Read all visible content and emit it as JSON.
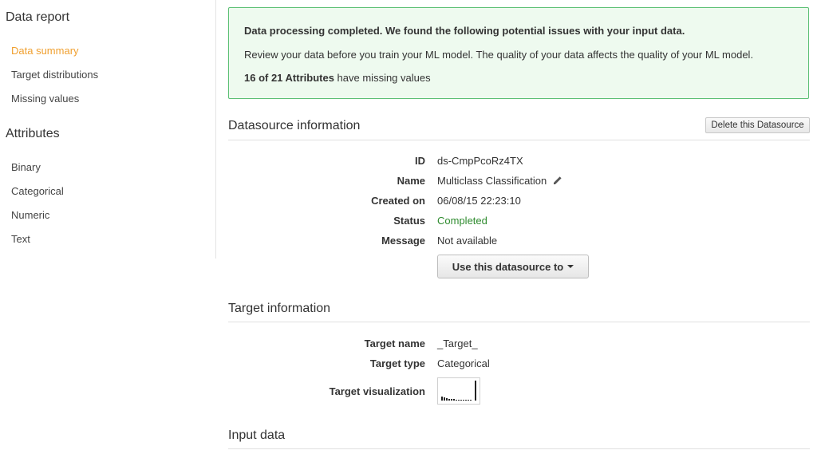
{
  "sidebar": {
    "heading_report": "Data report",
    "report_items": [
      "Data summary",
      "Target distributions",
      "Missing values"
    ],
    "heading_attributes": "Attributes",
    "attribute_items": [
      "Binary",
      "Categorical",
      "Numeric",
      "Text"
    ]
  },
  "alert": {
    "title": "Data processing completed. We found the following potential issues with your input data.",
    "message": "Review your data before you train your ML model. The quality of your data affects the quality of your ML model.",
    "missing_count": "16 of 21 Attributes",
    "missing_suffix": " have missing values"
  },
  "datasource": {
    "title": "Datasource information",
    "delete_label": "Delete this Datasource",
    "id_label": "ID",
    "id_value": "ds-CmpPcoRz4TX",
    "name_label": "Name",
    "name_value": "Multiclass Classification",
    "created_label": "Created on",
    "created_value": "06/08/15 22:23:10",
    "status_label": "Status",
    "status_value": "Completed",
    "message_label": "Message",
    "message_value": "Not available",
    "use_button_label": "Use this datasource to"
  },
  "target": {
    "title": "Target information",
    "name_label": "Target name",
    "name_value": "_Target_",
    "type_label": "Target type",
    "type_value": "Categorical",
    "viz_label": "Target visualization"
  },
  "input": {
    "title": "Input data"
  },
  "colors": {
    "accent_active": "#f0a030",
    "alert_border": "#5cc075",
    "alert_bg": "#eefaef",
    "status_completed": "#2e8b2e"
  }
}
